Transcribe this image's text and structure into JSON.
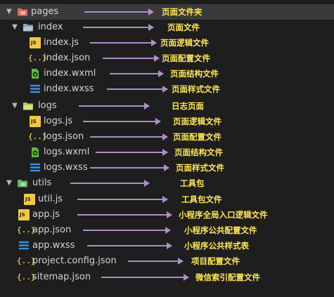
{
  "colors": {
    "background": "#1e1e1e",
    "selected_row": "#3a3a3a",
    "text": "#d4d4d4",
    "annotation": "#ffe84a",
    "connector": "#b08cc8",
    "js_icon": "#f0c93f",
    "wxml_icon": "#5fb832",
    "wxss_icon": "#3a8fe0",
    "folder_pages": "#e06b5a",
    "folder_index": "#8fa3b0",
    "folder_logs": "#b8c458",
    "folder_utils": "#62b36b"
  },
  "tree": {
    "items": [
      {
        "label": "pages",
        "icon": "folder-pages-icon",
        "expanded": true,
        "annotation": "页面文件夹"
      },
      {
        "label": "index",
        "icon": "folder-index-icon",
        "expanded": true,
        "annotation": "页面文件"
      },
      {
        "label": "index.js",
        "icon": "js-icon",
        "annotation": "页面逻辑文件"
      },
      {
        "label": "index.json",
        "icon": "json-icon",
        "annotation": "页面配置文件"
      },
      {
        "label": "index.wxml",
        "icon": "wxml-icon",
        "annotation": "页面结构文件"
      },
      {
        "label": "index.wxss",
        "icon": "wxss-icon",
        "annotation": "页面样式文件"
      },
      {
        "label": "logs",
        "icon": "folder-logs-icon",
        "expanded": true,
        "annotation": "日志页面"
      },
      {
        "label": "logs.js",
        "icon": "js-icon",
        "annotation": "页面逻辑文件"
      },
      {
        "label": "logs.json",
        "icon": "json-icon",
        "annotation": "页面配置文件"
      },
      {
        "label": "logs.wxml",
        "icon": "wxml-icon",
        "annotation": "页面结构文件"
      },
      {
        "label": "logs.wxss",
        "icon": "wxss-icon",
        "annotation": "页面样式文件"
      },
      {
        "label": "utils",
        "icon": "folder-utils-icon",
        "expanded": true,
        "annotation": "工具包"
      },
      {
        "label": "util.js",
        "icon": "js-icon",
        "annotation": "工具包文件"
      },
      {
        "label": "app.js",
        "icon": "js-icon",
        "annotation": "小程序全局入口逻辑文件"
      },
      {
        "label": "app.json",
        "icon": "json-icon",
        "annotation": "小程序公共配置文件"
      },
      {
        "label": "app.wxss",
        "icon": "wxss-icon",
        "annotation": "小程序公共样式表"
      },
      {
        "label": "project.config.json",
        "icon": "json-icon",
        "annotation": "项目配置文件"
      },
      {
        "label": "sitemap.json",
        "icon": "json-icon",
        "annotation": "微信索引配置文件"
      }
    ]
  }
}
